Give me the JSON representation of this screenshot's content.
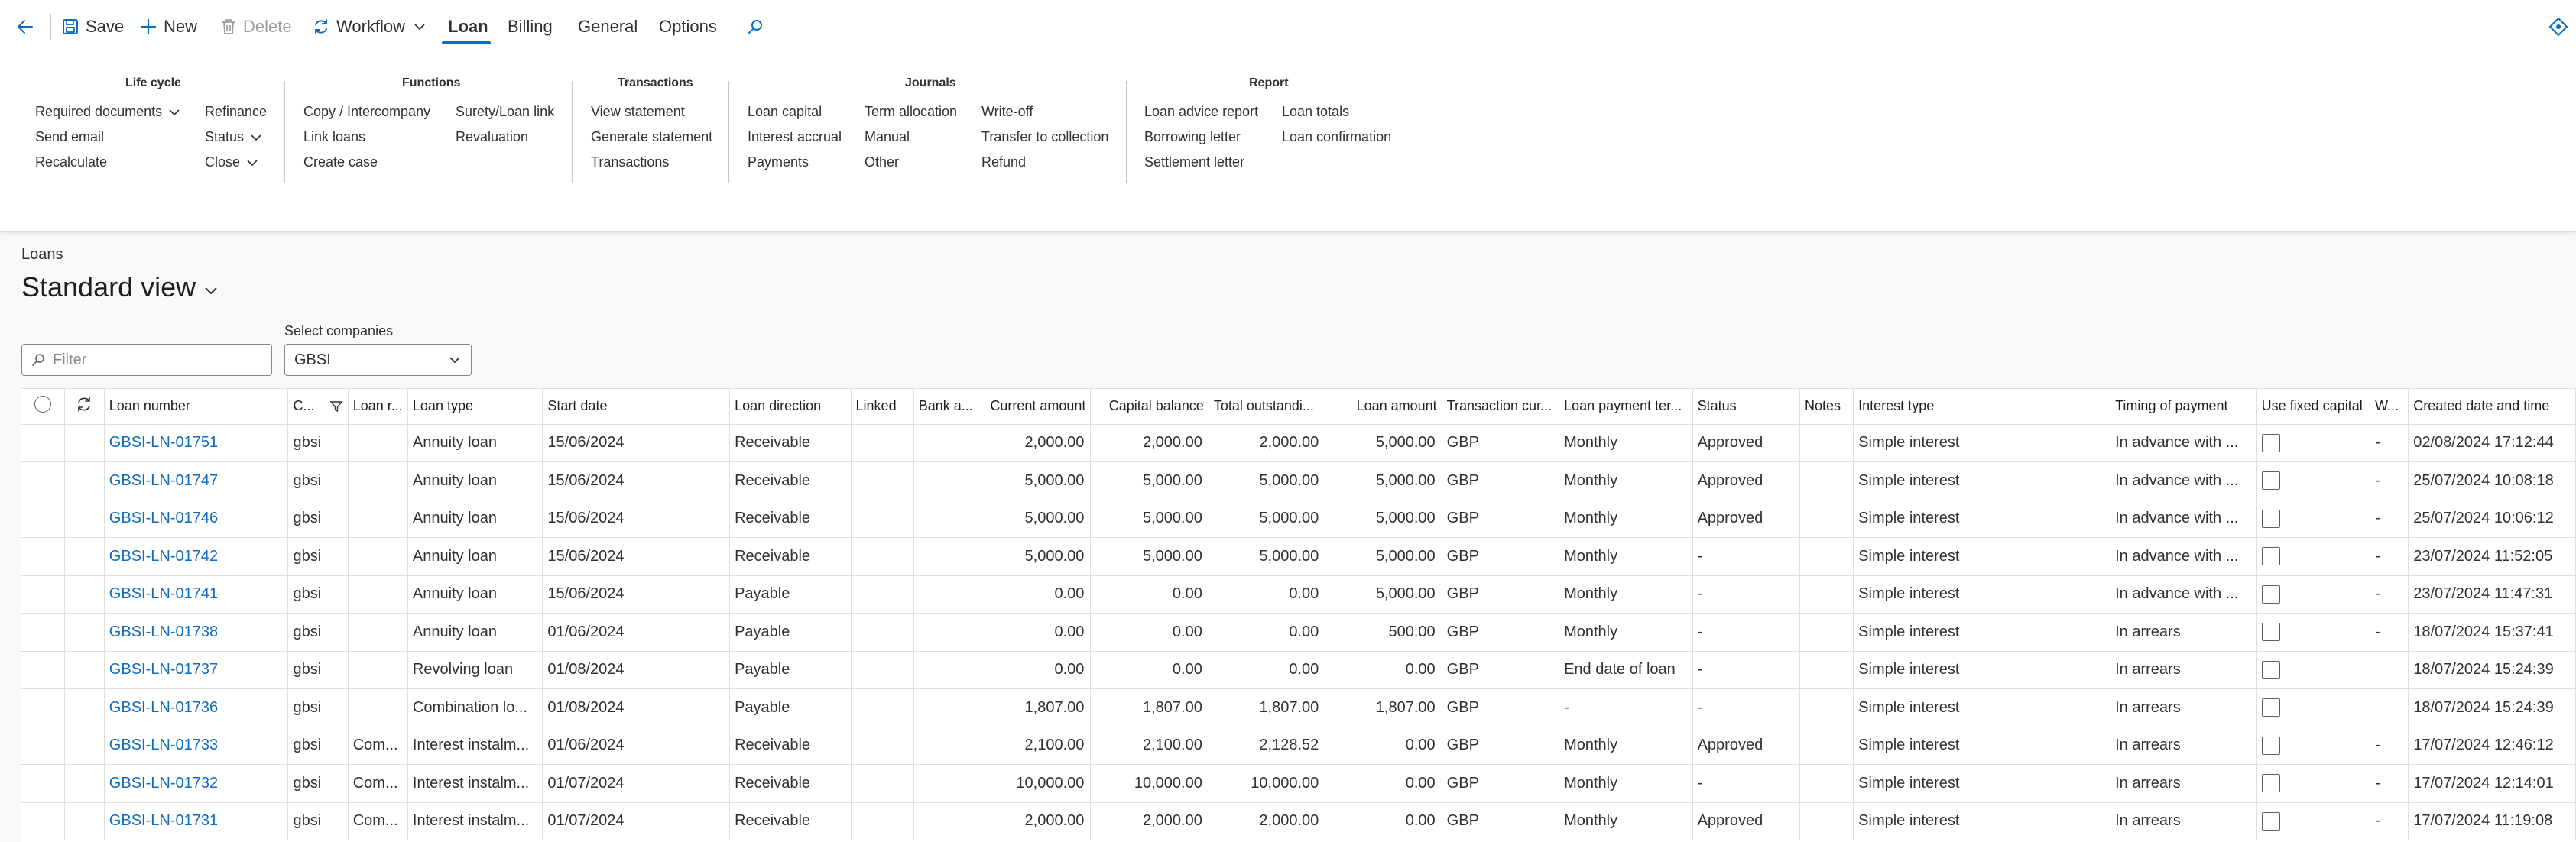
{
  "toolbar": {
    "save": "Save",
    "new": "New",
    "delete": "Delete",
    "workflow": "Workflow"
  },
  "tabs": [
    "Loan",
    "Billing",
    "General",
    "Options"
  ],
  "ribbon": {
    "lifecycle": {
      "title": "Life cycle",
      "required_documents": "Required documents",
      "send_email": "Send email",
      "recalculate": "Recalculate",
      "refinance": "Refinance",
      "status": "Status",
      "close": "Close"
    },
    "functions": {
      "title": "Functions",
      "copy_intercompany": "Copy / Intercompany",
      "link_loans": "Link loans",
      "create_case": "Create case",
      "surety_loan_link": "Surety/Loan link",
      "revaluation": "Revaluation"
    },
    "transactions": {
      "title": "Transactions",
      "view_statement": "View statement",
      "generate_statement": "Generate statement",
      "transactions": "Transactions"
    },
    "journals": {
      "title": "Journals",
      "loan_capital": "Loan capital",
      "interest_accrual": "Interest accrual",
      "payments": "Payments",
      "term_allocation": "Term allocation",
      "manual": "Manual",
      "other": "Other",
      "write_off": "Write-off",
      "transfer_to_collection": "Transfer to collection",
      "refund": "Refund"
    },
    "report": {
      "title": "Report",
      "loan_advice_report": "Loan advice report",
      "borrowing_letter": "Borrowing letter",
      "settlement_letter": "Settlement letter",
      "loan_totals": "Loan totals",
      "loan_confirmation": "Loan confirmation"
    }
  },
  "page": {
    "breadcrumb": "Loans",
    "view_title": "Standard view",
    "filter_placeholder": "Filter",
    "companies_label": "Select companies",
    "companies_value": "GBSI"
  },
  "grid": {
    "columns": [
      "Loan number",
      "C...",
      "Loan r...",
      "Loan type",
      "Start date",
      "Loan direction",
      "Linked",
      "Bank a...",
      "Current amount",
      "Capital balance",
      "Total outstandi...",
      "Loan amount",
      "Transaction cur...",
      "Loan payment ter...",
      "Status",
      "Notes",
      "Interest type",
      "Timing of payment",
      "Use fixed capital",
      "W...",
      "Created date and time"
    ],
    "rows": [
      [
        "GBSI-LN-01751",
        "gbsi",
        "",
        "Annuity loan",
        "15/06/2024",
        "Receivable",
        "",
        "",
        "2,000.00",
        "2,000.00",
        "2,000.00",
        "5,000.00",
        "GBP",
        "Monthly",
        "Approved",
        "",
        "Simple interest",
        "In advance with ...",
        "",
        "-",
        "02/08/2024 17:12:44"
      ],
      [
        "GBSI-LN-01747",
        "gbsi",
        "",
        "Annuity loan",
        "15/06/2024",
        "Receivable",
        "",
        "",
        "5,000.00",
        "5,000.00",
        "5,000.00",
        "5,000.00",
        "GBP",
        "Monthly",
        "Approved",
        "",
        "Simple interest",
        "In advance with ...",
        "",
        "-",
        "25/07/2024 10:08:18"
      ],
      [
        "GBSI-LN-01746",
        "gbsi",
        "",
        "Annuity loan",
        "15/06/2024",
        "Receivable",
        "",
        "",
        "5,000.00",
        "5,000.00",
        "5,000.00",
        "5,000.00",
        "GBP",
        "Monthly",
        "Approved",
        "",
        "Simple interest",
        "In advance with ...",
        "",
        "-",
        "25/07/2024 10:06:12"
      ],
      [
        "GBSI-LN-01742",
        "gbsi",
        "",
        "Annuity loan",
        "15/06/2024",
        "Receivable",
        "",
        "",
        "5,000.00",
        "5,000.00",
        "5,000.00",
        "5,000.00",
        "GBP",
        "Monthly",
        "-",
        "",
        "Simple interest",
        "In advance with ...",
        "",
        "-",
        "23/07/2024 11:52:05"
      ],
      [
        "GBSI-LN-01741",
        "gbsi",
        "",
        "Annuity loan",
        "15/06/2024",
        "Payable",
        "",
        "",
        "0.00",
        "0.00",
        "0.00",
        "5,000.00",
        "GBP",
        "Monthly",
        "-",
        "",
        "Simple interest",
        "In advance with ...",
        "",
        "-",
        "23/07/2024 11:47:31"
      ],
      [
        "GBSI-LN-01738",
        "gbsi",
        "",
        "Annuity loan",
        "01/06/2024",
        "Payable",
        "",
        "",
        "0.00",
        "0.00",
        "0.00",
        "500.00",
        "GBP",
        "Monthly",
        "-",
        "",
        "Simple interest",
        "In arrears",
        "",
        "-",
        "18/07/2024 15:37:41"
      ],
      [
        "GBSI-LN-01737",
        "gbsi",
        "",
        "Revolving loan",
        "01/08/2024",
        "Payable",
        "",
        "",
        "0.00",
        "0.00",
        "0.00",
        "0.00",
        "GBP",
        "End date of loan",
        "-",
        "",
        "Simple interest",
        "In arrears",
        "",
        "",
        "18/07/2024 15:24:39"
      ],
      [
        "GBSI-LN-01736",
        "gbsi",
        "",
        "Combination lo...",
        "01/08/2024",
        "Payable",
        "",
        "",
        "1,807.00",
        "1,807.00",
        "1,807.00",
        "1,807.00",
        "GBP",
        "-",
        "-",
        "",
        "Simple interest",
        "In arrears",
        "",
        "",
        "18/07/2024 15:24:39"
      ],
      [
        "GBSI-LN-01733",
        "gbsi",
        "Com...",
        "Interest instalm...",
        "01/06/2024",
        "Receivable",
        "",
        "",
        "2,100.00",
        "2,100.00",
        "2,128.52",
        "0.00",
        "GBP",
        "Monthly",
        "Approved",
        "",
        "Simple interest",
        "In arrears",
        "",
        "-",
        "17/07/2024 12:46:12"
      ],
      [
        "GBSI-LN-01732",
        "gbsi",
        "Com...",
        "Interest instalm...",
        "01/07/2024",
        "Receivable",
        "",
        "",
        "10,000.00",
        "10,000.00",
        "10,000.00",
        "0.00",
        "GBP",
        "Monthly",
        "-",
        "",
        "Simple interest",
        "In arrears",
        "",
        "-",
        "17/07/2024 12:14:01"
      ],
      [
        "GBSI-LN-01731",
        "gbsi",
        "Com...",
        "Interest instalm...",
        "01/07/2024",
        "Receivable",
        "",
        "",
        "2,000.00",
        "2,000.00",
        "2,000.00",
        "0.00",
        "GBP",
        "Monthly",
        "Approved",
        "",
        "Simple interest",
        "In arrears",
        "",
        "-",
        "17/07/2024 11:19:08"
      ]
    ]
  },
  "colors": {
    "accent": "#0f6cbd",
    "link": "#0f6cbd"
  }
}
